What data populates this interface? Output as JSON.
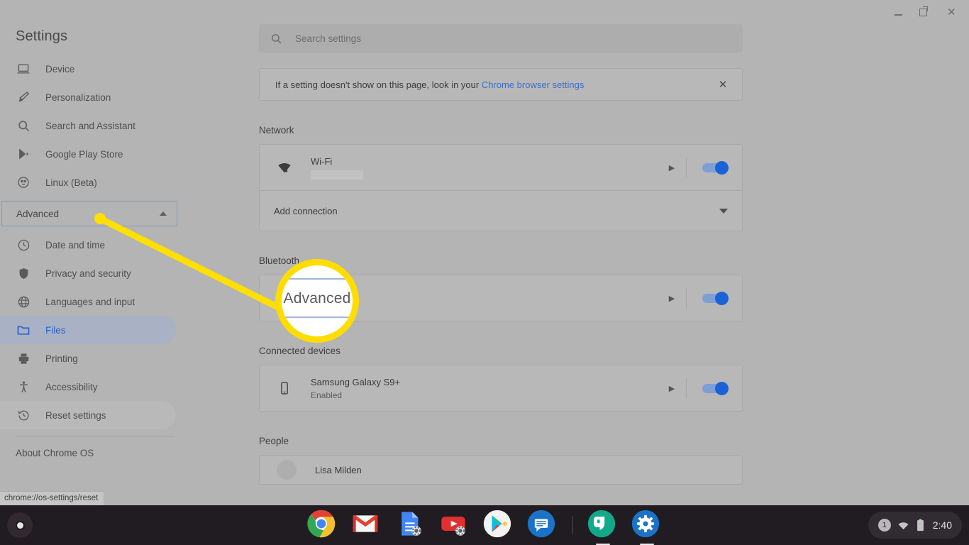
{
  "window": {
    "minimize_label": "Minimize",
    "maximize_label": "Maximize",
    "close_label": "Close"
  },
  "sidebar": {
    "title": "Settings",
    "items": [
      {
        "label": "Device",
        "icon": "laptop-icon",
        "state": "normal"
      },
      {
        "label": "Personalization",
        "icon": "brush-icon",
        "state": "normal"
      },
      {
        "label": "Search and Assistant",
        "icon": "search-icon",
        "state": "normal"
      },
      {
        "label": "Google Play Store",
        "icon": "play-store-icon",
        "state": "normal"
      },
      {
        "label": "Linux (Beta)",
        "icon": "linux-penguin-icon",
        "state": "normal"
      }
    ],
    "advanced": {
      "label": "Advanced",
      "expanded": true,
      "icon": "chevron-up-icon"
    },
    "advanced_items": [
      {
        "label": "Date and time",
        "icon": "clock-icon",
        "state": "normal"
      },
      {
        "label": "Privacy and security",
        "icon": "shield-icon",
        "state": "normal"
      },
      {
        "label": "Languages and input",
        "icon": "globe-icon",
        "state": "normal"
      },
      {
        "label": "Files",
        "icon": "folder-icon",
        "state": "selected"
      },
      {
        "label": "Printing",
        "icon": "printer-icon",
        "state": "normal"
      },
      {
        "label": "Accessibility",
        "icon": "accessibility-icon",
        "state": "normal"
      },
      {
        "label": "Reset settings",
        "icon": "history-icon",
        "state": "hovered"
      }
    ],
    "about": {
      "label": "About Chrome OS"
    }
  },
  "status_url": "chrome://os-settings/reset",
  "search": {
    "placeholder": "Search settings",
    "icon": "search-icon"
  },
  "notice": {
    "text_before": "If a setting doesn't show on this page, look in your ",
    "link_text": "Chrome browser settings",
    "close_icon": "close-icon"
  },
  "sections": {
    "network": {
      "title": "Network",
      "wifi": {
        "name": "Wi-Fi",
        "ssid_redacted": true,
        "icon": "wifi-lock-icon",
        "arrow": "chevron-right-icon",
        "toggle_on": true
      },
      "add_connection": {
        "label": "Add connection",
        "icon": "chevron-down-icon"
      }
    },
    "bluetooth": {
      "title": "Bluetooth",
      "row": {
        "icon": "bluetooth-icon",
        "arrow": "chevron-right-icon",
        "toggle_on": true
      }
    },
    "connected_devices": {
      "title": "Connected devices",
      "device": {
        "name": "Samsung Galaxy S9+",
        "status": "Enabled",
        "icon": "phone-icon",
        "arrow": "chevron-right-icon",
        "toggle_on": true
      }
    },
    "people": {
      "title": "People",
      "user_partial": "Lisa Milden"
    }
  },
  "callout": {
    "magnified_label": "Advanced",
    "highlight_color": "#ffdd00"
  },
  "shelf": {
    "launcher_label": "Launcher",
    "apps": [
      {
        "name": "Google Chrome",
        "icon": "chrome-icon",
        "active": false
      },
      {
        "name": "Gmail",
        "icon": "gmail-icon",
        "active": false
      },
      {
        "name": "Google Docs",
        "icon": "docs-icon",
        "active": false
      },
      {
        "name": "YouTube",
        "icon": "youtube-icon",
        "active": false
      },
      {
        "name": "Google Play Store",
        "icon": "play-store-icon",
        "active": false
      },
      {
        "name": "Messages",
        "icon": "messages-icon",
        "active": false
      },
      {
        "name": "Hangouts",
        "icon": "hangouts-icon",
        "active": true
      },
      {
        "name": "Settings",
        "icon": "gear-icon",
        "active": true
      }
    ],
    "tray": {
      "notification_count": "1",
      "wifi_icon": "wifi-icon",
      "battery_icon": "battery-icon",
      "clock": "2:40"
    }
  }
}
